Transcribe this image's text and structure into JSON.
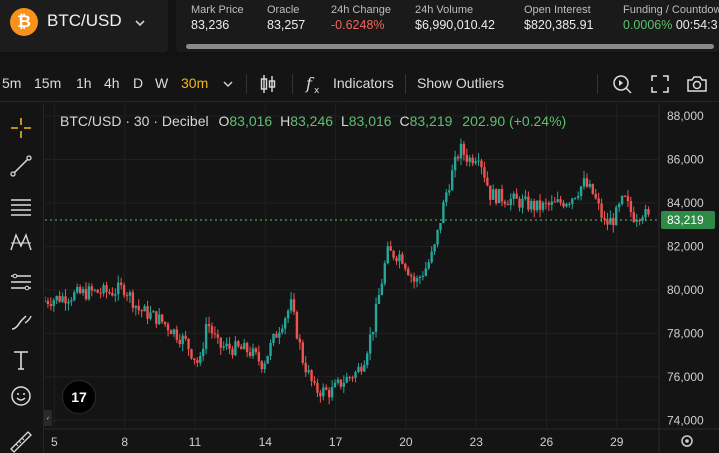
{
  "symbol": {
    "name": "BTC/USD",
    "logo_glyph": "₿",
    "dropdown_icon": "chevron-down-icon"
  },
  "stats": [
    {
      "label": "Mark Price",
      "value": "83,236",
      "tone": "neutral"
    },
    {
      "label": "Oracle",
      "value": "83,257",
      "tone": "neutral"
    },
    {
      "label": "24h Change",
      "value": "-0.6248%",
      "tone": "negative"
    },
    {
      "label": "24h Volume",
      "value": "$6,990,010.42",
      "tone": "neutral"
    },
    {
      "label": "Open Interest",
      "value": "$820,385.91",
      "tone": "neutral"
    },
    {
      "label": "Funding / Countdown",
      "value": "0.0006%",
      "value2": "00:54:3",
      "tone": "positive"
    }
  ],
  "toolbar": {
    "timeframes": [
      "5m",
      "15m",
      "1h",
      "4h",
      "D",
      "W",
      "30m"
    ],
    "active_timeframe": "30m",
    "indicators_label": "Indicators",
    "outliers_label": "Show Outliers"
  },
  "legend": {
    "name": "BTC/USD · 30 · Decibel",
    "o_key": "O",
    "o_val": "83,016",
    "h_key": "H",
    "h_val": "83,246",
    "l_key": "L",
    "l_val": "83,016",
    "c_key": "C",
    "c_val": "83,219",
    "change": "202.90 (+0.24%)"
  },
  "colors": {
    "up": "#26a69a",
    "down": "#ef5350",
    "accent": "#f2b51f",
    "price_tag": "#2e8b47"
  },
  "tv_logo_text": "17",
  "chart_data": {
    "type": "candlestick",
    "x_tick_labels": [
      "5",
      "8",
      "11",
      "14",
      "17",
      "20",
      "23",
      "26",
      "29"
    ],
    "x_tick_days": [
      5,
      8,
      11,
      14,
      17,
      20,
      23,
      26,
      29
    ],
    "y_tick_labels": [
      "74,000",
      "76,000",
      "78,000",
      "80,000",
      "82,000",
      "84,000",
      "86,000",
      "88,000"
    ],
    "y_ticks": [
      74000,
      76000,
      78000,
      80000,
      82000,
      84000,
      86000,
      88000
    ],
    "ylim": [
      73600,
      88600
    ],
    "xlim": [
      4.6,
      30.8
    ],
    "last_price": 83219,
    "last_price_label": "83,219",
    "path_days": [
      4.6,
      5.5,
      6.5,
      7.4,
      8.0,
      8.6,
      9.4,
      10.0,
      10.6,
      11.2,
      11.5,
      12.0,
      12.7,
      13.3,
      13.9,
      14.6,
      15.1,
      15.6,
      16.1,
      16.8,
      17.3,
      17.9,
      18.2,
      18.6,
      19.2,
      19.8,
      20.4,
      20.9,
      21.2,
      21.7,
      22.3,
      22.7,
      23.1,
      23.6,
      24.3,
      25.0,
      25.6,
      26.3,
      27.0,
      27.6,
      28.0,
      28.5,
      28.9,
      29.3,
      29.7,
      30.1,
      30.4
    ],
    "path_prices": [
      79500,
      79700,
      79900,
      79900,
      80100,
      79100,
      78700,
      78200,
      77600,
      76500,
      78600,
      77400,
      77300,
      77200,
      76600,
      78300,
      79300,
      76800,
      75400,
      75300,
      75800,
      76200,
      76800,
      78300,
      81700,
      81600,
      80300,
      81100,
      81800,
      84400,
      86500,
      86000,
      86300,
      84400,
      84200,
      84000,
      83800,
      83900,
      84200,
      84900,
      84400,
      83000,
      83300,
      84200,
      83400,
      83600,
      83219
    ],
    "candle_step_days": 0.125
  }
}
